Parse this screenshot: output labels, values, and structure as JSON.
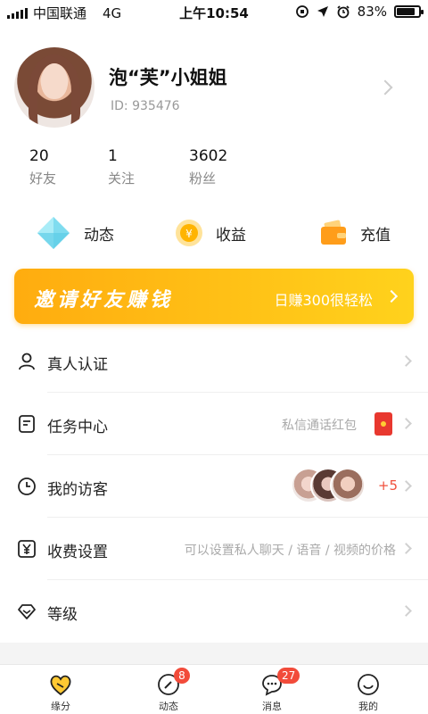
{
  "status_bar": {
    "carrier": "中国联通",
    "network": "4G",
    "time": "上午10:54",
    "battery_pct": "83%",
    "battery_level": 0.83
  },
  "profile": {
    "name": "泡“芙”小姐姐",
    "id_label": "ID:",
    "id_value": "935476"
  },
  "stats": [
    {
      "num": "20",
      "label": "好友"
    },
    {
      "num": "1",
      "label": "关注"
    },
    {
      "num": "3602",
      "label": "粉丝"
    }
  ],
  "quick_actions": [
    {
      "label": "动态",
      "icon": "dynamics-icon"
    },
    {
      "label": "收益",
      "icon": "coin-icon"
    },
    {
      "label": "充值",
      "icon": "wallet-icon"
    }
  ],
  "invite": {
    "title": "邀请好友赚钱",
    "subtitle": "日赚300很轻松"
  },
  "menu": [
    {
      "label": "真人认证",
      "icon": "person-icon",
      "hint": ""
    },
    {
      "label": "任务中心",
      "icon": "task-icon",
      "hint": "私信通话红包"
    },
    {
      "label": "我的访客",
      "icon": "clock-icon",
      "hint": "+5"
    },
    {
      "label": "收费设置",
      "icon": "yuan-icon",
      "hint": "可以设置私人聊天 / 语音 / 视频的价格"
    },
    {
      "label": "等级",
      "icon": "level-icon",
      "hint": ""
    }
  ],
  "tabbar": [
    {
      "label": "缘分",
      "icon": "heart-icon",
      "badge": ""
    },
    {
      "label": "动态",
      "icon": "compass-icon",
      "badge": "8"
    },
    {
      "label": "消息",
      "icon": "message-icon",
      "badge": "27"
    },
    {
      "label": "我的",
      "icon": "smile-icon",
      "badge": ""
    }
  ],
  "colors": {
    "accent": "#FFB400",
    "badge": "#F24B3A",
    "visitor_count": "#F0503C"
  }
}
